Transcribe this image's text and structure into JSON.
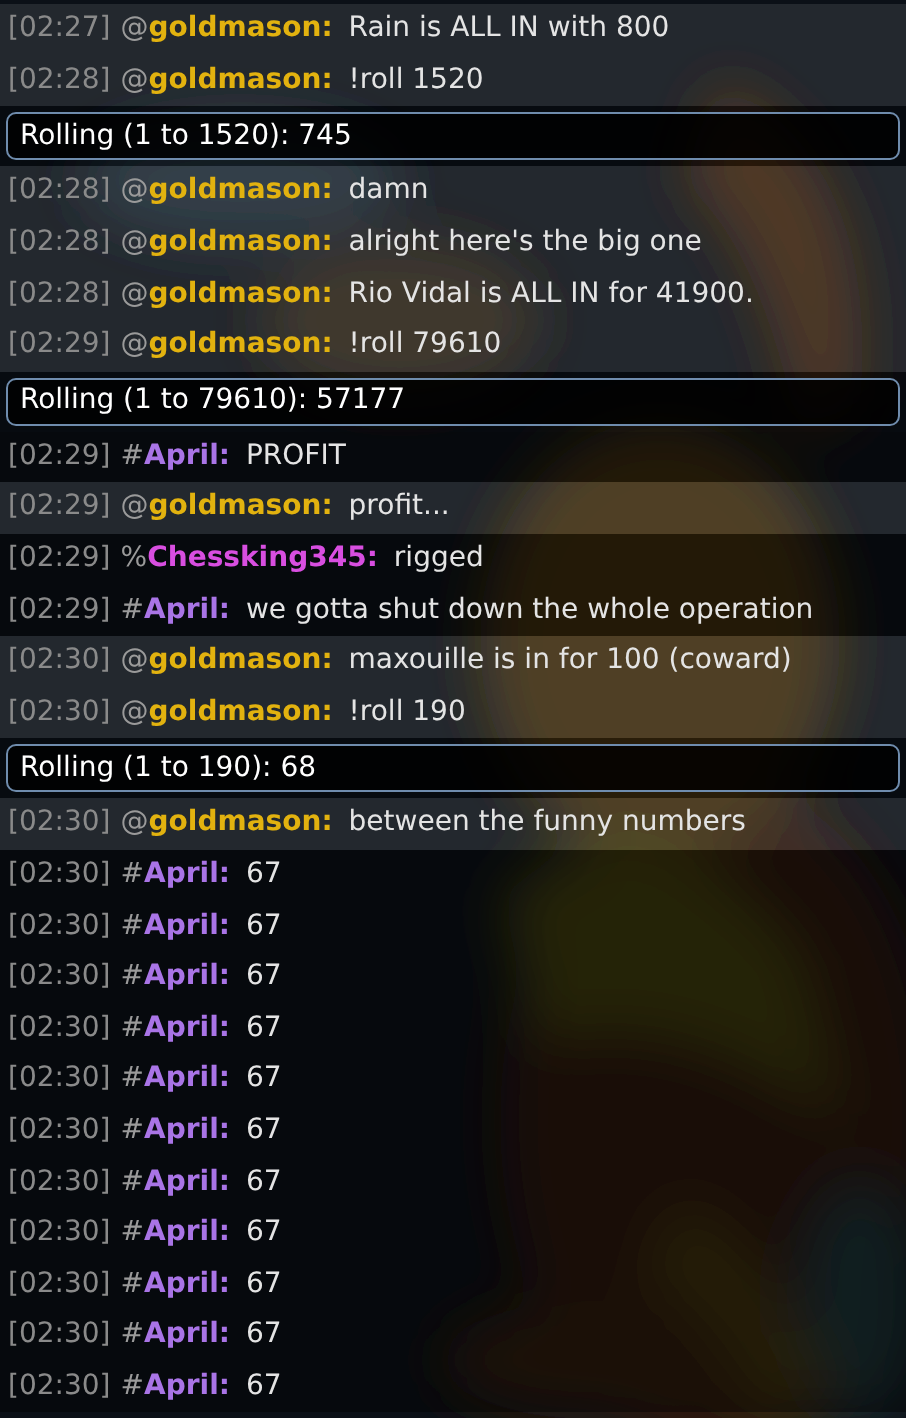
{
  "messages": [
    {
      "kind": "chat",
      "time": "[02:27]",
      "prefix": "@",
      "user": "goldmason:",
      "color": "#e2b20f",
      "text": "Rain is ALL IN with 800",
      "shaded": true
    },
    {
      "kind": "chat",
      "time": "[02:28]",
      "prefix": "@",
      "user": "goldmason:",
      "color": "#e2b20f",
      "text": "!roll 1520",
      "shaded": true
    },
    {
      "kind": "roll",
      "text": "Rolling (1 to 1520): 745"
    },
    {
      "kind": "chat",
      "time": "[02:28]",
      "prefix": "@",
      "user": "goldmason:",
      "color": "#e2b20f",
      "text": "damn",
      "shaded": true
    },
    {
      "kind": "chat",
      "time": "[02:28]",
      "prefix": "@",
      "user": "goldmason:",
      "color": "#e2b20f",
      "text": "alright here's the big one",
      "shaded": true
    },
    {
      "kind": "chat",
      "time": "[02:28]",
      "prefix": "@",
      "user": "goldmason:",
      "color": "#e2b20f",
      "text": "Rio Vidal is ALL IN for 41900.",
      "shaded": true
    },
    {
      "kind": "chat",
      "time": "[02:29]",
      "prefix": "@",
      "user": "goldmason:",
      "color": "#e2b20f",
      "text": "!roll 79610",
      "shaded": true
    },
    {
      "kind": "roll",
      "text": "Rolling (1 to 79610): 57177"
    },
    {
      "kind": "chat",
      "time": "[02:29]",
      "prefix": "#",
      "user": "April:",
      "color": "#a974e6",
      "text": "PROFIT",
      "shaded": false
    },
    {
      "kind": "chat",
      "time": "[02:29]",
      "prefix": "@",
      "user": "goldmason:",
      "color": "#e2b20f",
      "text": "profit...",
      "shaded": true
    },
    {
      "kind": "chat",
      "time": "[02:29]",
      "prefix": "%",
      "user": "Chessking345:",
      "color": "#d84ee0",
      "text": "rigged",
      "shaded": false
    },
    {
      "kind": "chat",
      "time": "[02:29]",
      "prefix": "#",
      "user": "April:",
      "color": "#a974e6",
      "text": "we gotta shut down the whole operation",
      "shaded": false
    },
    {
      "kind": "chat",
      "time": "[02:30]",
      "prefix": "@",
      "user": "goldmason:",
      "color": "#e2b20f",
      "text": "maxouille is in for 100 (coward)",
      "shaded": true
    },
    {
      "kind": "chat",
      "time": "[02:30]",
      "prefix": "@",
      "user": "goldmason:",
      "color": "#e2b20f",
      "text": "!roll 190",
      "shaded": true
    },
    {
      "kind": "roll",
      "text": "Rolling (1 to 190): 68"
    },
    {
      "kind": "chat",
      "time": "[02:30]",
      "prefix": "@",
      "user": "goldmason:",
      "color": "#e2b20f",
      "text": "between the funny numbers",
      "shaded": true
    },
    {
      "kind": "chat",
      "time": "[02:30]",
      "prefix": "#",
      "user": "April:",
      "color": "#a974e6",
      "text": "67",
      "shaded": false
    },
    {
      "kind": "chat",
      "time": "[02:30]",
      "prefix": "#",
      "user": "April:",
      "color": "#a974e6",
      "text": "67",
      "shaded": false
    },
    {
      "kind": "chat",
      "time": "[02:30]",
      "prefix": "#",
      "user": "April:",
      "color": "#a974e6",
      "text": "67",
      "shaded": false
    },
    {
      "kind": "chat",
      "time": "[02:30]",
      "prefix": "#",
      "user": "April:",
      "color": "#a974e6",
      "text": "67",
      "shaded": false
    },
    {
      "kind": "chat",
      "time": "[02:30]",
      "prefix": "#",
      "user": "April:",
      "color": "#a974e6",
      "text": "67",
      "shaded": false
    },
    {
      "kind": "chat",
      "time": "[02:30]",
      "prefix": "#",
      "user": "April:",
      "color": "#a974e6",
      "text": "67",
      "shaded": false
    },
    {
      "kind": "chat",
      "time": "[02:30]",
      "prefix": "#",
      "user": "April:",
      "color": "#a974e6",
      "text": "67",
      "shaded": false
    },
    {
      "kind": "chat",
      "time": "[02:30]",
      "prefix": "#",
      "user": "April:",
      "color": "#a974e6",
      "text": "67",
      "shaded": false
    },
    {
      "kind": "chat",
      "time": "[02:30]",
      "prefix": "#",
      "user": "April:",
      "color": "#a974e6",
      "text": "67",
      "shaded": false
    },
    {
      "kind": "chat",
      "time": "[02:30]",
      "prefix": "#",
      "user": "April:",
      "color": "#a974e6",
      "text": "67",
      "shaded": false
    },
    {
      "kind": "chat",
      "time": "[02:30]",
      "prefix": "#",
      "user": "April:",
      "color": "#a974e6",
      "text": "67",
      "shaded": false
    }
  ]
}
